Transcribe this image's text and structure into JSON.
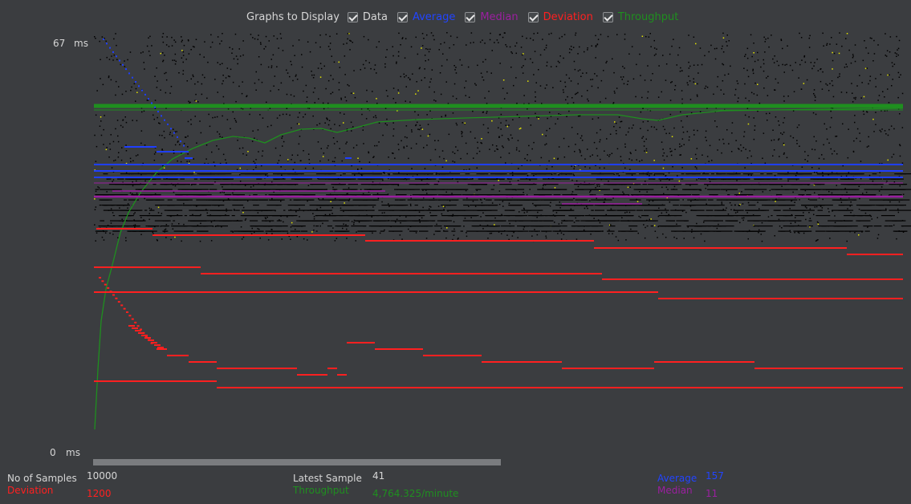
{
  "legend": {
    "title": "Graphs to Display",
    "items": [
      {
        "label": "Data",
        "color": "#d6d6d6",
        "checked": true
      },
      {
        "label": "Average",
        "color": "#1f3fff",
        "checked": true
      },
      {
        "label": "Median",
        "color": "#9b1fa0",
        "checked": true
      },
      {
        "label": "Deviation",
        "color": "#ff2020",
        "checked": true
      },
      {
        "label": "Throughput",
        "color": "#1f8f1f",
        "checked": true
      }
    ]
  },
  "y_axis": {
    "max": "67",
    "min": "0",
    "unit": "ms"
  },
  "stats": {
    "samples_label": "No of Samples",
    "samples_value": "10000",
    "latest_label": "Latest Sample",
    "latest_value": "41",
    "average_label": "Average",
    "average_value": "157",
    "deviation_label": "Deviation",
    "deviation_value": "1200",
    "throughput_label": "Throughput",
    "throughput_value": "4,764.325/minute",
    "median_label": "Median",
    "median_value": "11"
  },
  "colors": {
    "background": "#3b3d40",
    "data": "#000000",
    "data_highlight": "#e6e600",
    "average": "#1f3fff",
    "median": "#9b1fa0",
    "deviation": "#ff2020",
    "throughput": "#1f8f1f"
  }
}
